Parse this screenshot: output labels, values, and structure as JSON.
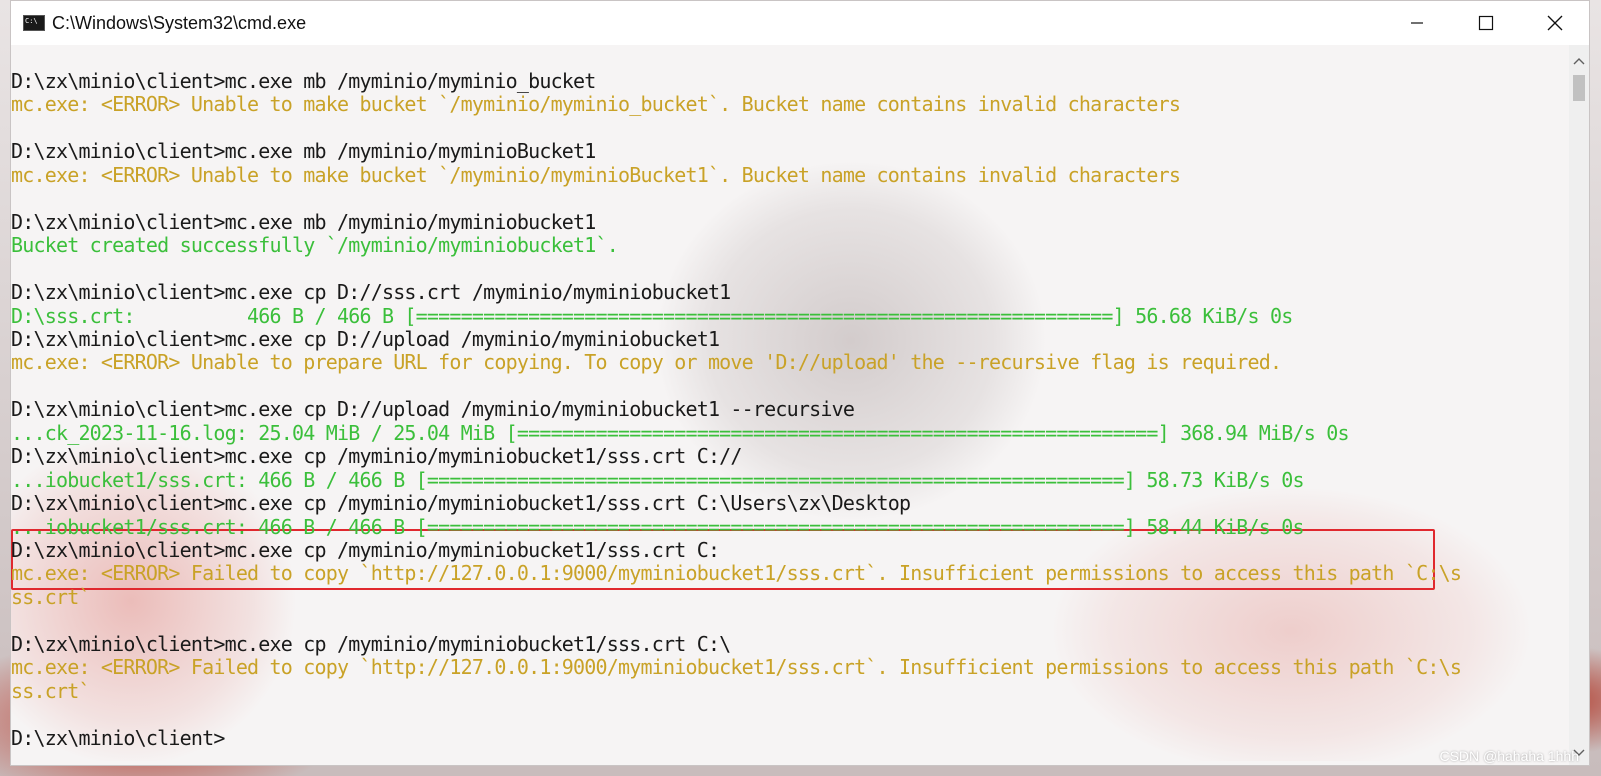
{
  "window": {
    "title": "C:\\Windows\\System32\\cmd.exe"
  },
  "colors": {
    "prompt": "#1a1a1a",
    "error": "#c9a227",
    "success": "#3bbf3b",
    "highlight_box": "#e0282e"
  },
  "console": {
    "lines": [
      {
        "text": "D:\\zx\\minio\\client>mc.exe mb /myminio/myminio_bucket",
        "color": "white"
      },
      {
        "text": "mc.exe: <ERROR> Unable to make bucket `/myminio/myminio_bucket`. Bucket name contains invalid characters",
        "color": "yellow"
      },
      {
        "text": "",
        "color": "white"
      },
      {
        "text": "D:\\zx\\minio\\client>mc.exe mb /myminio/myminioBucket1",
        "color": "white"
      },
      {
        "text": "mc.exe: <ERROR> Unable to make bucket `/myminio/myminioBucket1`. Bucket name contains invalid characters",
        "color": "yellow"
      },
      {
        "text": "",
        "color": "white"
      },
      {
        "text": "D:\\zx\\minio\\client>mc.exe mb /myminio/myminiobucket1",
        "color": "white"
      },
      {
        "text": "Bucket created successfully `/myminio/myminiobucket1`.",
        "color": "green"
      },
      {
        "text": "",
        "color": "white"
      },
      {
        "text": "D:\\zx\\minio\\client>mc.exe cp D://sss.crt /myminio/myminiobucket1",
        "color": "white"
      },
      {
        "text": "D:\\sss.crt:          466 B / 466 B [==============================================================] 56.68 KiB/s 0s",
        "color": "green"
      },
      {
        "text": "D:\\zx\\minio\\client>mc.exe cp D://upload /myminio/myminiobucket1",
        "color": "white"
      },
      {
        "text": "mc.exe: <ERROR> Unable to prepare URL for copying. To copy or move 'D://upload' the --recursive flag is required.",
        "color": "yellow"
      },
      {
        "text": "",
        "color": "white"
      },
      {
        "text": "D:\\zx\\minio\\client>mc.exe cp D://upload /myminio/myminiobucket1 --recursive",
        "color": "white"
      },
      {
        "text": "...ck_2023-11-16.log: 25.04 MiB / 25.04 MiB [=========================================================] 368.94 MiB/s 0s",
        "color": "green"
      },
      {
        "text": "D:\\zx\\minio\\client>mc.exe cp /myminio/myminiobucket1/sss.crt C://",
        "color": "white"
      },
      {
        "text": "...iobucket1/sss.crt: 466 B / 466 B [==============================================================] 58.73 KiB/s 0s",
        "color": "green"
      },
      {
        "text": "D:\\zx\\minio\\client>mc.exe cp /myminio/myminiobucket1/sss.crt C:\\Users\\zx\\Desktop",
        "color": "white"
      },
      {
        "text": "...iobucket1/sss.crt: 466 B / 466 B [==============================================================] 58.44 KiB/s 0s",
        "color": "green"
      },
      {
        "text": "D:\\zx\\minio\\client>mc.exe cp /myminio/myminiobucket1/sss.crt C:",
        "color": "white"
      },
      {
        "text": "mc.exe: <ERROR> Failed to copy `http://127.0.0.1:9000/myminiobucket1/sss.crt`. Insufficient permissions to access this path `C:\\s",
        "color": "yellow"
      },
      {
        "text": "ss.crt`",
        "color": "yellow"
      },
      {
        "text": "",
        "color": "white"
      },
      {
        "text": "D:\\zx\\minio\\client>mc.exe cp /myminio/myminiobucket1/sss.crt C:\\",
        "color": "white"
      },
      {
        "text": "mc.exe: <ERROR> Failed to copy `http://127.0.0.1:9000/myminiobucket1/sss.crt`. Insufficient permissions to access this path `C:\\s",
        "color": "yellow"
      },
      {
        "text": "ss.crt`",
        "color": "yellow"
      },
      {
        "text": "",
        "color": "white"
      },
      {
        "text": "D:\\zx\\minio\\client>",
        "color": "white"
      }
    ]
  },
  "watermark": "CSDN @hahaha 1hhh"
}
